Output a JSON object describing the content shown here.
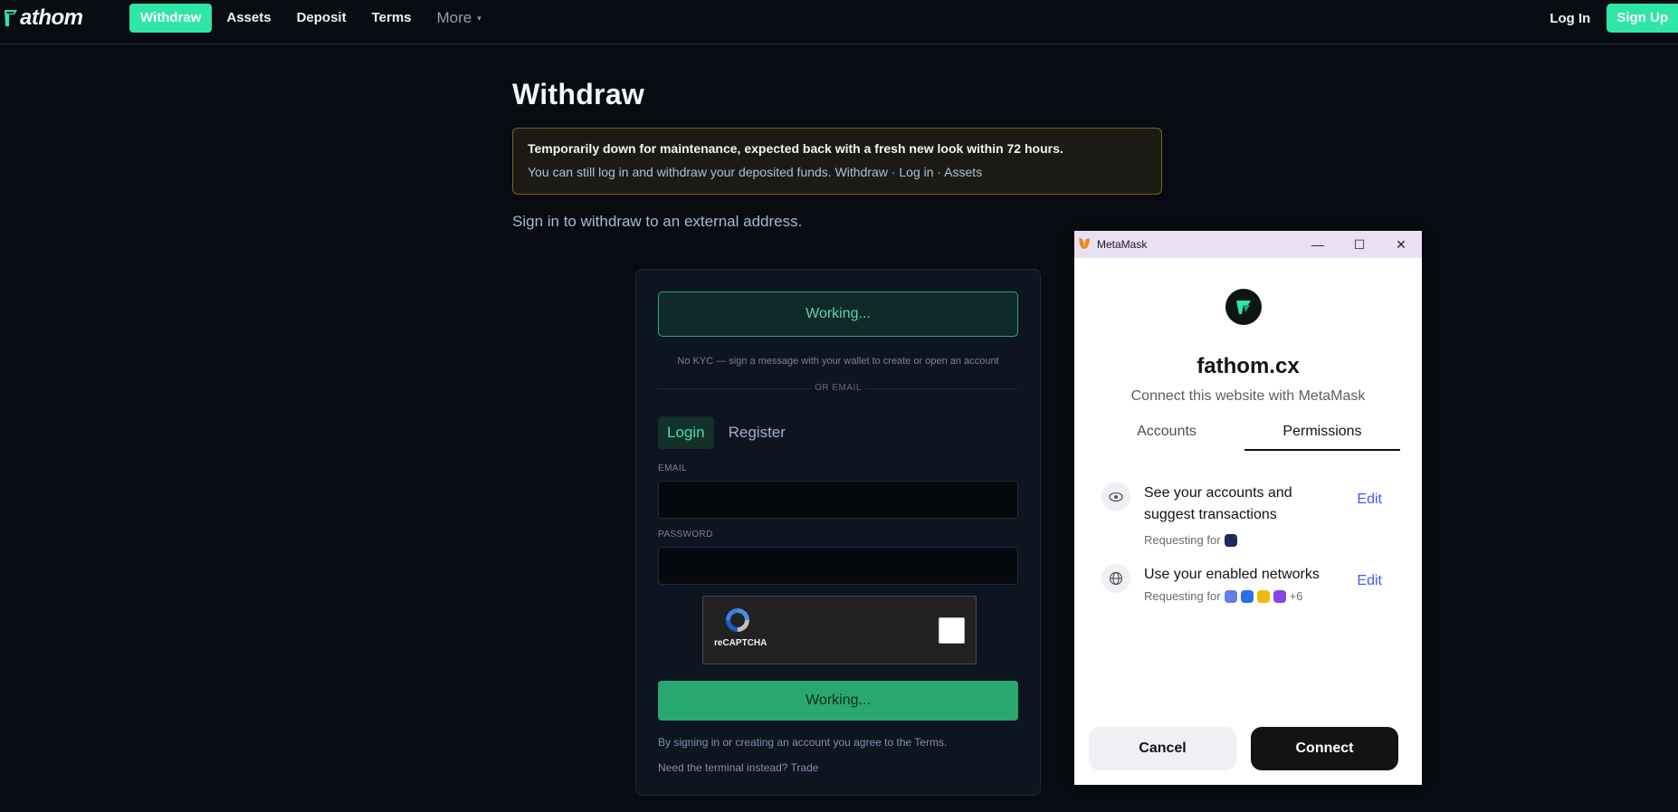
{
  "header": {
    "logo_text": "athom",
    "nav": [
      {
        "label": "Withdraw"
      },
      {
        "label": "Assets"
      },
      {
        "label": "Deposit"
      },
      {
        "label": "Terms"
      },
      {
        "label": "More",
        "caret": "▾"
      }
    ],
    "login_label": "Log In",
    "signup_label": "Sign Up",
    "accent_color": "#2ee6a6"
  },
  "main": {
    "title": "Withdraw",
    "notice": {
      "line1": "Temporarily down for maintenance, expected back with a fresh new look within 72 hours.",
      "line2": "You can still log in and withdraw your deposited funds. Withdraw · Log in · Assets"
    },
    "subtitle": "Sign in to withdraw to an external address."
  },
  "auth_card": {
    "wallet_button_label": "Working...",
    "kyc_note": "No KYC — sign a message with your wallet to create or open an account",
    "divider_text": "OR EMAIL",
    "tabs": [
      {
        "label": "Login"
      },
      {
        "label": "Register"
      }
    ],
    "email_label": "EMAIL",
    "email_value": "",
    "password_label": "PASSWORD",
    "password_value": "",
    "captcha_label": "reCAPTCHA",
    "submit_label": "Working...",
    "terms_note": "By signing in or creating an account you agree to the Terms.",
    "terminal_note": "Need the terminal instead? Trade"
  },
  "metamask": {
    "window_title": "MetaMask",
    "minimize_glyph": "—",
    "maximize_glyph": "☐",
    "close_glyph": "✕",
    "site": "fathom.cx",
    "subtitle": "Connect this website with MetaMask",
    "tabs": [
      {
        "label": "Accounts"
      },
      {
        "label": "Permissions"
      }
    ],
    "active_tab": "Permissions",
    "permissions": [
      {
        "title": "See your accounts and suggest transactions",
        "requesting_label": "Requesting for",
        "edit_label": "Edit",
        "icon": "eye-icon"
      },
      {
        "title": "Use your enabled networks",
        "requesting_label": "Requesting for",
        "extra_count": "+6",
        "edit_label": "Edit",
        "icon": "globe-icon"
      }
    ],
    "network_colors": [
      "#627eea",
      "#2b6def",
      "#f0b90b",
      "#8247e5"
    ],
    "cancel_label": "Cancel",
    "connect_label": "Connect"
  }
}
